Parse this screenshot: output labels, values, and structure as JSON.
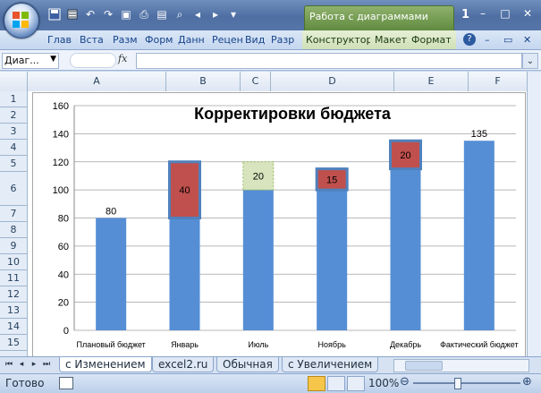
{
  "titlebar": {
    "context_title": "Работа с диаграммами",
    "window_number": "1",
    "minimize": "–",
    "restore": "□",
    "close": "✕",
    "qat_more": "▾"
  },
  "ribbon": {
    "tabs": [
      "Глав",
      "Вста",
      "Разм",
      "Форм",
      "Данн",
      "Рецен",
      "Вид",
      "Разр"
    ],
    "context_tabs": [
      "Конструктор",
      "Макет",
      "Формат"
    ],
    "help": "?"
  },
  "formula_bar": {
    "name_box": "Диаг...",
    "fx": "fx",
    "value": ""
  },
  "columns": [
    "A",
    "B",
    "C",
    "D",
    "E",
    "F"
  ],
  "rows": [
    "1",
    "2",
    "3",
    "4",
    "5",
    "6",
    "7",
    "8",
    "9",
    "10",
    "11",
    "12",
    "13",
    "14",
    "15"
  ],
  "chart_data": {
    "type": "bar",
    "title": "Корректировки бюджета",
    "categories": [
      "Плановый бюджет",
      "Январь",
      "Июль",
      "Ноябрь",
      "Декабрь",
      "Фактический бюджет"
    ],
    "ylim": [
      0,
      160
    ],
    "y_ticks": [
      "0",
      "20",
      "40",
      "60",
      "80",
      "100",
      "120",
      "140",
      "160"
    ],
    "grid": true,
    "series": [
      {
        "values": [
          80,
          80,
          100,
          100,
          115,
          135
        ],
        "color": "#558ed5"
      },
      {
        "values": [
          0,
          40,
          0,
          15,
          20,
          0
        ],
        "color": "#c0504d"
      },
      {
        "values": [
          0,
          0,
          20,
          0,
          0,
          0
        ],
        "color": "#d7e4bd"
      }
    ],
    "data_labels": [
      "80",
      "40",
      "20",
      "15",
      "20",
      "135"
    ]
  },
  "sheet_tabs": [
    "с Изменением",
    "excel2.ru",
    "Обычная",
    "с Увеличением"
  ],
  "status": {
    "ready": "Готово",
    "zoom": "100%"
  }
}
